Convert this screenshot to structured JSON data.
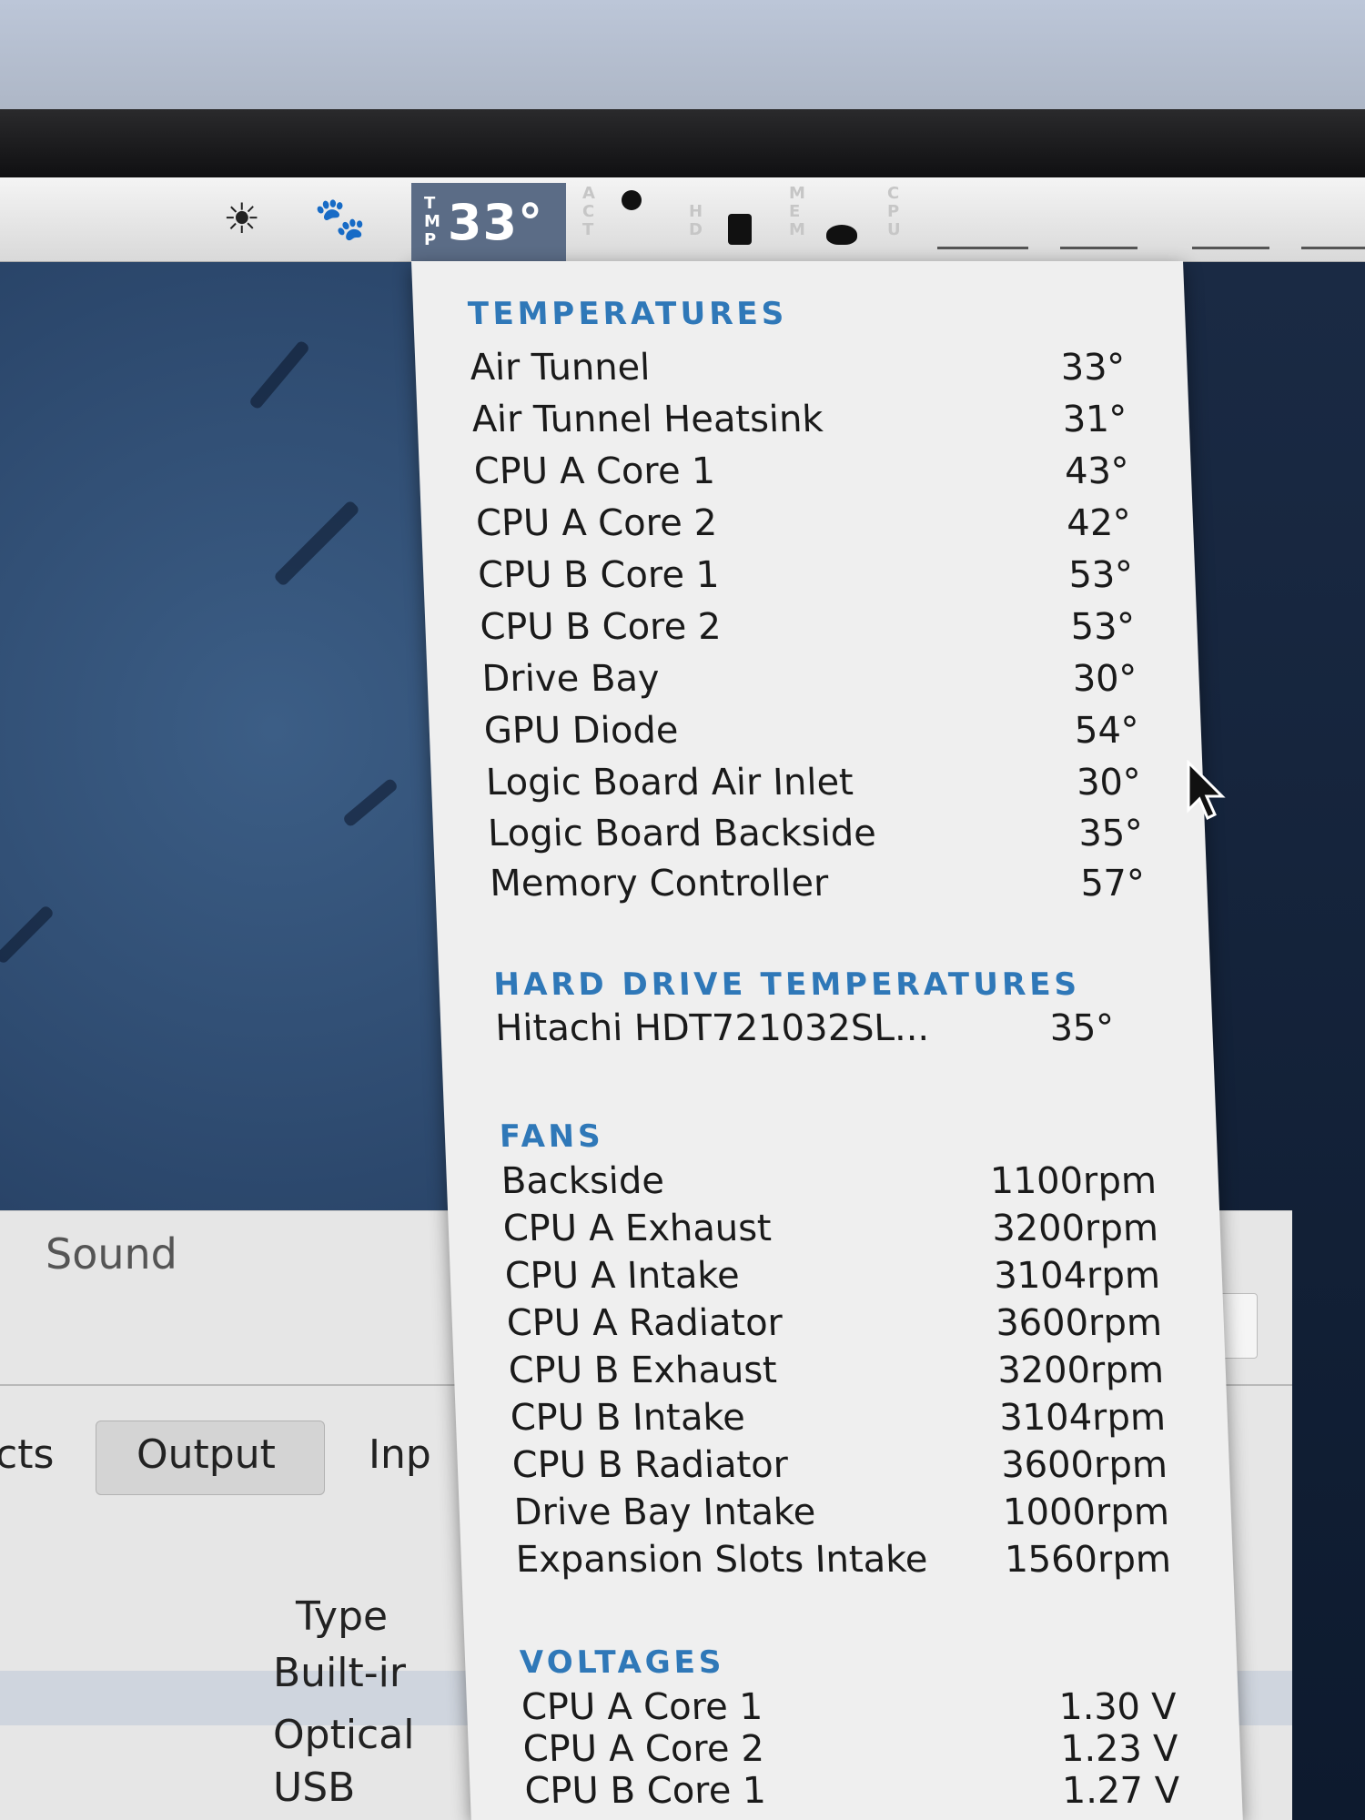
{
  "menubar": {
    "tmp_letters": [
      "T",
      "M",
      "P"
    ],
    "tmp_value": "33°",
    "act_letters": [
      "A",
      "C",
      "T"
    ],
    "hd_letters": [
      "H",
      "D"
    ],
    "mem_letters": [
      "M",
      "E",
      "M"
    ],
    "cpu_letters": [
      "C",
      "P",
      "U"
    ],
    "icons": [
      "brightness-icon",
      "paw-icon"
    ]
  },
  "menu": {
    "temperatures": {
      "title": "TEMPERATURES",
      "items": [
        {
          "label": "Air Tunnel",
          "value": "33°"
        },
        {
          "label": "Air Tunnel Heatsink",
          "value": "31°"
        },
        {
          "label": "CPU A Core 1",
          "value": "43°"
        },
        {
          "label": "CPU A Core 2",
          "value": "42°"
        },
        {
          "label": "CPU B Core 1",
          "value": "53°"
        },
        {
          "label": "CPU B Core 2",
          "value": "53°"
        },
        {
          "label": "Drive Bay",
          "value": "30°"
        },
        {
          "label": "GPU Diode",
          "value": "54°"
        },
        {
          "label": "Logic Board Air Inlet",
          "value": "30°"
        },
        {
          "label": "Logic Board Backside",
          "value": "35°"
        },
        {
          "label": "Memory Controller",
          "value": "57°"
        }
      ]
    },
    "hard_drive": {
      "title": "HARD DRIVE TEMPERATURES",
      "items": [
        {
          "label": "Hitachi HDT721032SL...",
          "value": "35°"
        }
      ]
    },
    "fans": {
      "title": "FANS",
      "items": [
        {
          "label": "Backside",
          "value": "1100rpm"
        },
        {
          "label": "CPU A Exhaust",
          "value": "3200rpm"
        },
        {
          "label": "CPU A Intake",
          "value": "3104rpm"
        },
        {
          "label": "CPU A Radiator",
          "value": "3600rpm"
        },
        {
          "label": "CPU B Exhaust",
          "value": "3200rpm"
        },
        {
          "label": "CPU B Intake",
          "value": "3104rpm"
        },
        {
          "label": "CPU B Radiator",
          "value": "3600rpm"
        },
        {
          "label": "Drive Bay Intake",
          "value": "1000rpm"
        },
        {
          "label": "Expansion Slots Intake",
          "value": "1560rpm"
        }
      ]
    },
    "voltages": {
      "title": "VOLTAGES",
      "items": [
        {
          "label": "CPU A Core 1",
          "value": "1.30 V"
        },
        {
          "label": "CPU A Core 2",
          "value": "1.23 V"
        },
        {
          "label": "CPU B Core 1",
          "value": "1.27 V"
        }
      ]
    }
  },
  "window": {
    "title": "Sound",
    "tabs": [
      "cts",
      "Output",
      "Inp"
    ],
    "list_header": "Type",
    "list_items": [
      "Built-ir",
      "Optical",
      "USB"
    ]
  },
  "colors": {
    "section_title": "#2f78b8",
    "menu_bg": "#efefef",
    "menubar_highlight": "#5b6c86"
  }
}
